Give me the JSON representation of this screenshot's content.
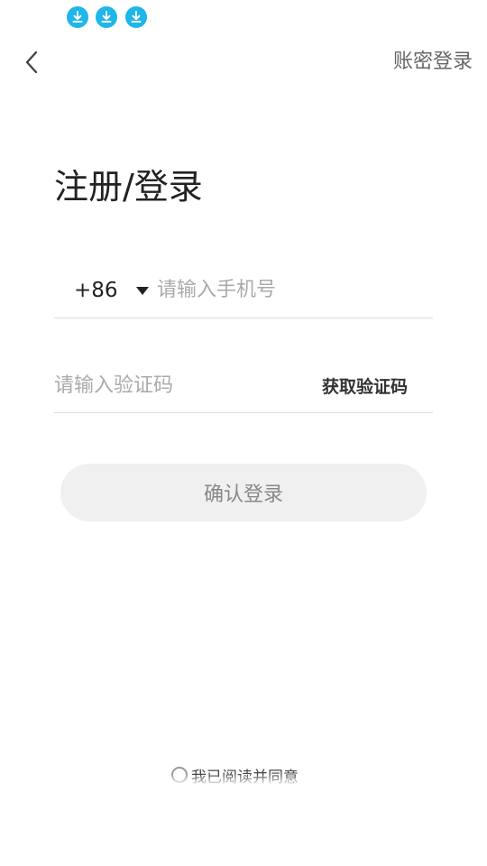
{
  "status_bar": {
    "icons": [
      "download-icon",
      "download-icon",
      "download-icon"
    ],
    "icon_color": "#1fb6ea"
  },
  "nav": {
    "back_icon": "chevron-left-icon",
    "account_login_label": "账密登录"
  },
  "page": {
    "title": "注册/登录"
  },
  "phone": {
    "country_code": "+86",
    "caret_icon": "caret-down-icon",
    "placeholder": "请输入手机号",
    "value": ""
  },
  "code": {
    "placeholder": "请输入验证码",
    "value": "",
    "get_code_label": "获取验证码"
  },
  "confirm": {
    "label": "确认登录",
    "background": "#f0f0f0"
  },
  "agreement": {
    "checked": false,
    "text": "我已阅读并同意"
  }
}
